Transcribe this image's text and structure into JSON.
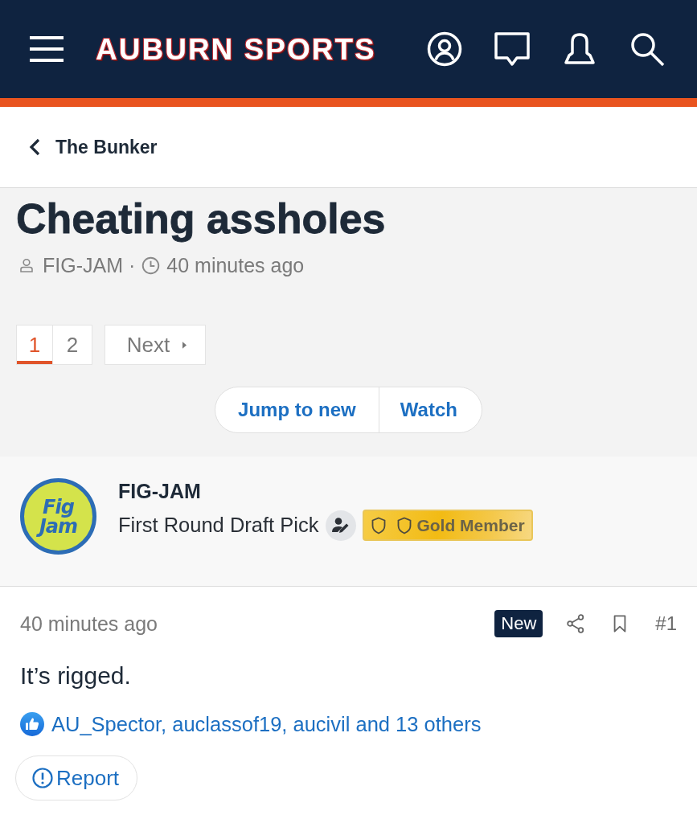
{
  "header": {
    "logo": "AUBURN SPORTS"
  },
  "breadcrumb": {
    "label": "The Bunker"
  },
  "thread": {
    "title": "Cheating assholes",
    "author": "FIG-JAM",
    "separator": "·",
    "time": "40 minutes ago"
  },
  "pagination": {
    "pages": [
      {
        "label": "1",
        "selected": true
      },
      {
        "label": "2",
        "selected": false
      }
    ],
    "next": "Next"
  },
  "thread_actions": [
    "Jump to new",
    "Watch"
  ],
  "post": {
    "user": {
      "avatar_text": "Fig Jam",
      "name": "FIG-JAM",
      "title": "First Round Draft Pick",
      "badge": "Gold Member"
    },
    "time": "40 minutes ago",
    "new_badge": "New",
    "number": "#1",
    "body": "It’s rigged.",
    "reactions": "AU_Spector, auclassof19, aucivil and 13 others",
    "report": "Report"
  }
}
